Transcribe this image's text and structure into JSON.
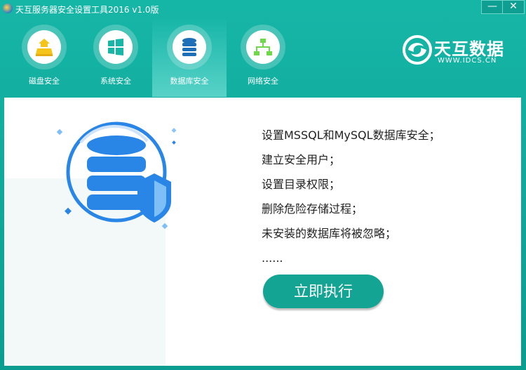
{
  "window": {
    "title": "天互服务器安全设置工具2016 v1.0版",
    "minimize_label": "—",
    "close_label": "✕"
  },
  "tabs": [
    {
      "label": "磁盘安全",
      "icon": "disk-icon",
      "active": false
    },
    {
      "label": "系统安全",
      "icon": "windows-icon",
      "active": false
    },
    {
      "label": "数据库安全",
      "icon": "database-icon",
      "active": true
    },
    {
      "label": "网络安全",
      "icon": "network-icon",
      "active": false
    }
  ],
  "brand": {
    "name": "天互数据",
    "url": "WWW.IDCS.CN"
  },
  "info_lines": [
    "设置MSSQL和MySQL数据库安全；",
    "建立安全用户；",
    "设置目录权限；",
    "删除危险存储过程；",
    "未安装的数据库将被忽略；",
    "......"
  ],
  "run_button": "立即执行",
  "colors": {
    "teal": "#0fa597",
    "icon_blue": "#2a86e6",
    "icon_green": "#6ed84a",
    "icon_yellow": "#f5c41a"
  }
}
